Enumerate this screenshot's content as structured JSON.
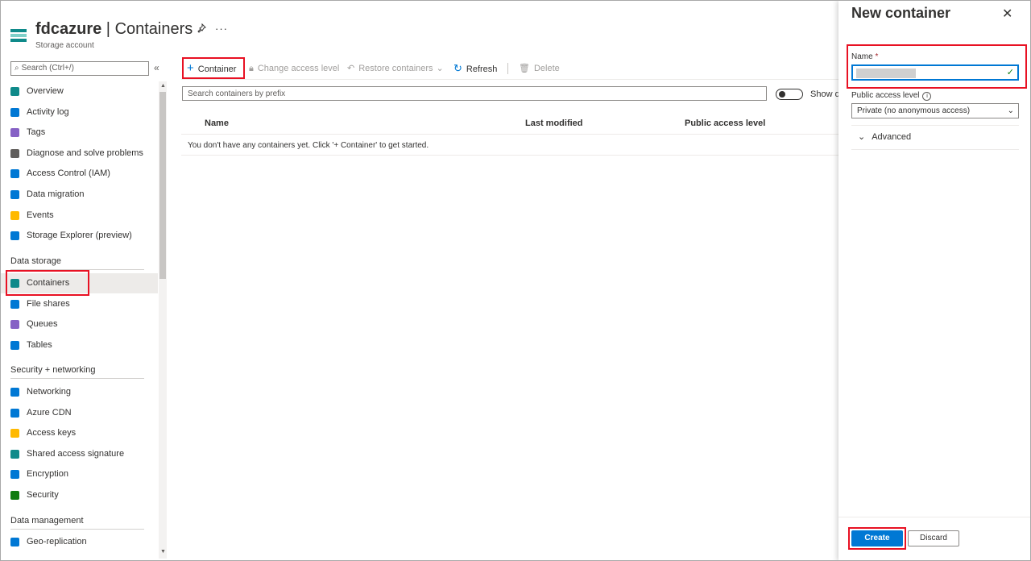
{
  "header": {
    "resource_name": "fdcazure",
    "separator": " | ",
    "blade_title": "Containers",
    "subtitle": "Storage account",
    "pin_icon": "pin-icon",
    "more_icon": "more-icon"
  },
  "sidebar": {
    "search_placeholder": "Search (Ctrl+/)",
    "collapse_glyph": "«",
    "items": [
      {
        "label": "Overview",
        "icon": "overview-icon",
        "color": "#0f8a8a"
      },
      {
        "label": "Activity log",
        "icon": "activity-log-icon",
        "color": "#0078d4"
      },
      {
        "label": "Tags",
        "icon": "tag-icon",
        "color": "#8661c5"
      },
      {
        "label": "Diagnose and solve problems",
        "icon": "wrench-icon",
        "color": "#605e5c"
      },
      {
        "label": "Access Control (IAM)",
        "icon": "people-icon",
        "color": "#0078d4"
      },
      {
        "label": "Data migration",
        "icon": "data-migration-icon",
        "color": "#0078d4"
      },
      {
        "label": "Events",
        "icon": "lightning-icon",
        "color": "#ffb900"
      },
      {
        "label": "Storage Explorer (preview)",
        "icon": "storage-explorer-icon",
        "color": "#0078d4"
      }
    ],
    "section_data_storage": "Data storage",
    "data_storage_items": [
      {
        "label": "Containers",
        "icon": "containers-icon",
        "color": "#0f8a8a"
      },
      {
        "label": "File shares",
        "icon": "file-shares-icon",
        "color": "#0078d4"
      },
      {
        "label": "Queues",
        "icon": "queues-icon",
        "color": "#8661c5"
      },
      {
        "label": "Tables",
        "icon": "tables-icon",
        "color": "#0078d4"
      }
    ],
    "section_security": "Security + networking",
    "security_items": [
      {
        "label": "Networking",
        "icon": "networking-icon",
        "color": "#0078d4"
      },
      {
        "label": "Azure CDN",
        "icon": "cloud-icon",
        "color": "#0078d4"
      },
      {
        "label": "Access keys",
        "icon": "key-icon",
        "color": "#ffb900"
      },
      {
        "label": "Shared access signature",
        "icon": "link-icon",
        "color": "#0f8a8a"
      },
      {
        "label": "Encryption",
        "icon": "lock-icon",
        "color": "#0078d4"
      },
      {
        "label": "Security",
        "icon": "shield-icon",
        "color": "#107c10"
      }
    ],
    "section_data_management": "Data management",
    "data_management_items": [
      {
        "label": "Geo-replication",
        "icon": "globe-icon",
        "color": "#0078d4"
      }
    ]
  },
  "toolbar": {
    "add_container": "Container",
    "change_access": "Change access level",
    "restore": "Restore containers",
    "refresh": "Refresh",
    "delete": "Delete"
  },
  "list": {
    "filter_placeholder": "Search containers by prefix",
    "show_deleted": "Show d",
    "columns": [
      "Name",
      "Last modified",
      "Public access level"
    ],
    "empty_message": "You don't have any containers yet. Click '+ Container' to get started."
  },
  "panel": {
    "title": "New container",
    "name_label": "Name",
    "required_mark": "*",
    "name_value": "",
    "public_access_label": "Public access level",
    "public_access_value": "Private (no anonymous access)",
    "advanced_label": "Advanced",
    "create_label": "Create",
    "discard_label": "Discard"
  },
  "colors": {
    "accent": "#0078d4",
    "highlight": "#e81123"
  }
}
